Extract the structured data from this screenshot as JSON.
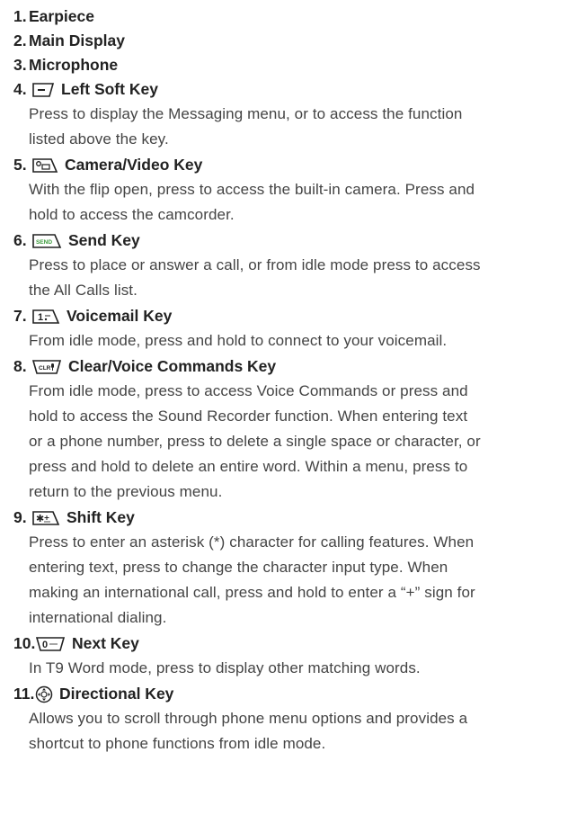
{
  "items": [
    {
      "number": "1.",
      "title": "Earpiece"
    },
    {
      "number": "2.",
      "title": "Main Display"
    },
    {
      "number": "3.",
      "title": "Microphone"
    },
    {
      "number": "4.",
      "title": "Left Soft Key",
      "icon": "left-soft-key-icon",
      "desc": [
        "Press to display the Messaging menu, or to access the function",
        "listed above the key."
      ]
    },
    {
      "number": "5.",
      "title": "Camera/Video Key",
      "icon": "camera-key-icon",
      "desc": [
        "With the flip open, press to access the built-in camera. Press and",
        "hold to access the camcorder."
      ]
    },
    {
      "number": "6.",
      "title": "Send Key",
      "icon": "send-key-icon",
      "icon_text": "SEND",
      "icon_color": "#3a9a3a",
      "desc": [
        "Press to place or answer a call, or from idle mode press to access",
        "the All Calls list."
      ]
    },
    {
      "number": "7.",
      "title": "Voicemail Key",
      "icon": "voicemail-key-icon",
      "icon_text": "1",
      "desc": [
        "From idle mode, press and hold to connect to your voicemail."
      ]
    },
    {
      "number": "8.",
      "title": "Clear/Voice Commands Key",
      "icon": "clear-key-icon",
      "icon_text": "CLR",
      "desc": [
        "From idle mode, press to access Voice Commands or press and",
        "hold to access the Sound Recorder function. When entering text",
        "or a phone number, press to delete a single space or character, or",
        "press and hold to delete an entire word. Within a menu, press to",
        "return to the previous menu."
      ]
    },
    {
      "number": "9.",
      "title": "Shift Key",
      "icon": "shift-key-icon",
      "icon_text": "✱",
      "desc": [
        "Press to enter an asterisk (*) character for calling features. When",
        "entering text, press to change the character input type. When",
        "making an international call, press and hold to enter a “+” sign for",
        "international dialing."
      ]
    },
    {
      "number": "10.",
      "title": "Next Key",
      "icon": "next-key-icon",
      "icon_text": "0",
      "desc": [
        "In T9 Word mode, press to display other matching words."
      ]
    },
    {
      "number": "11.",
      "title": "Directional Key",
      "icon": "directional-key-icon",
      "desc": [
        "Allows you to scroll through phone menu options and provides a",
        "shortcut to phone functions from idle mode."
      ]
    }
  ]
}
